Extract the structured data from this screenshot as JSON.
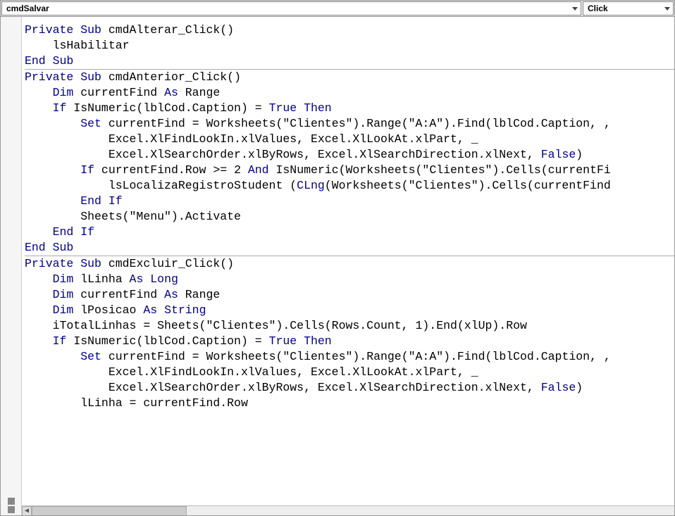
{
  "dropdowns": {
    "object": "cmdSalvar",
    "procedure": "Click"
  },
  "code": {
    "lines": [
      [
        [
          "kw",
          "Private"
        ],
        [
          "txt",
          " "
        ],
        [
          "kw",
          "Sub"
        ],
        [
          "txt",
          " cmdAlterar_Click()"
        ]
      ],
      [
        [
          "txt",
          "    lsHabilitar"
        ]
      ],
      [
        [
          "kw",
          "End"
        ],
        [
          "txt",
          " "
        ],
        [
          "kw",
          "Sub"
        ]
      ],
      "sep",
      [
        [
          "txt",
          ""
        ]
      ],
      [
        [
          "kw",
          "Private"
        ],
        [
          "txt",
          " "
        ],
        [
          "kw",
          "Sub"
        ],
        [
          "txt",
          " cmdAnterior_Click()"
        ]
      ],
      [
        [
          "txt",
          "    "
        ],
        [
          "kw",
          "Dim"
        ],
        [
          "txt",
          " currentFind "
        ],
        [
          "kw",
          "As"
        ],
        [
          "txt",
          " Range"
        ]
      ],
      [
        [
          "txt",
          ""
        ]
      ],
      [
        [
          "txt",
          "    "
        ],
        [
          "kw",
          "If"
        ],
        [
          "txt",
          " IsNumeric(lblCod.Caption) = "
        ],
        [
          "kw",
          "True"
        ],
        [
          "txt",
          " "
        ],
        [
          "kw",
          "Then"
        ]
      ],
      [
        [
          "txt",
          "        "
        ],
        [
          "kw",
          "Set"
        ],
        [
          "txt",
          " currentFind = Worksheets(\"Clientes\").Range(\"A:A\").Find(lblCod.Caption, ,"
        ]
      ],
      [
        [
          "txt",
          "            Excel.XlFindLookIn.xlValues, Excel.XlLookAt.xlPart, _"
        ]
      ],
      [
        [
          "txt",
          "            Excel.XlSearchOrder.xlByRows, Excel.XlSearchDirection.xlNext, "
        ],
        [
          "kw",
          "False"
        ],
        [
          "txt",
          ")"
        ]
      ],
      [
        [
          "txt",
          ""
        ]
      ],
      [
        [
          "txt",
          "        "
        ],
        [
          "kw",
          "If"
        ],
        [
          "txt",
          " currentFind.Row >= 2 "
        ],
        [
          "kw",
          "And"
        ],
        [
          "txt",
          " IsNumeric(Worksheets(\"Clientes\").Cells(currentFi"
        ]
      ],
      [
        [
          "txt",
          "            lsLocalizaRegistroStudent ("
        ],
        [
          "kw",
          "CLng"
        ],
        [
          "txt",
          "(Worksheets(\"Clientes\").Cells(currentFind"
        ]
      ],
      [
        [
          "txt",
          "        "
        ],
        [
          "kw",
          "End"
        ],
        [
          "txt",
          " "
        ],
        [
          "kw",
          "If"
        ]
      ],
      [
        [
          "txt",
          "        Sheets(\"Menu\").Activate"
        ]
      ],
      [
        [
          "txt",
          "    "
        ],
        [
          "kw",
          "End"
        ],
        [
          "txt",
          " "
        ],
        [
          "kw",
          "If"
        ]
      ],
      [
        [
          "kw",
          "End"
        ],
        [
          "txt",
          " "
        ],
        [
          "kw",
          "Sub"
        ]
      ],
      "sep",
      [
        [
          "txt",
          ""
        ]
      ],
      [
        [
          "kw",
          "Private"
        ],
        [
          "txt",
          " "
        ],
        [
          "kw",
          "Sub"
        ],
        [
          "txt",
          " cmdExcluir_Click()"
        ]
      ],
      [
        [
          "txt",
          "    "
        ],
        [
          "kw",
          "Dim"
        ],
        [
          "txt",
          " lLinha "
        ],
        [
          "kw",
          "As"
        ],
        [
          "txt",
          " "
        ],
        [
          "kw",
          "Long"
        ]
      ],
      [
        [
          "txt",
          "    "
        ],
        [
          "kw",
          "Dim"
        ],
        [
          "txt",
          " currentFind "
        ],
        [
          "kw",
          "As"
        ],
        [
          "txt",
          " Range"
        ]
      ],
      [
        [
          "txt",
          "    "
        ],
        [
          "kw",
          "Dim"
        ],
        [
          "txt",
          " lPosicao "
        ],
        [
          "kw",
          "As"
        ],
        [
          "txt",
          " "
        ],
        [
          "kw",
          "String"
        ]
      ],
      [
        [
          "txt",
          ""
        ]
      ],
      [
        [
          "txt",
          "    iTotalLinhas = Sheets(\"Clientes\").Cells(Rows.Count, 1).End(xlUp).Row"
        ]
      ],
      [
        [
          "txt",
          ""
        ]
      ],
      [
        [
          "txt",
          "    "
        ],
        [
          "kw",
          "If"
        ],
        [
          "txt",
          " IsNumeric(lblCod.Caption) = "
        ],
        [
          "kw",
          "True"
        ],
        [
          "txt",
          " "
        ],
        [
          "kw",
          "Then"
        ]
      ],
      [
        [
          "txt",
          "        "
        ],
        [
          "kw",
          "Set"
        ],
        [
          "txt",
          " currentFind = Worksheets(\"Clientes\").Range(\"A:A\").Find(lblCod.Caption, ,"
        ]
      ],
      [
        [
          "txt",
          "            Excel.XlFindLookIn.xlValues, Excel.XlLookAt.xlPart, _"
        ]
      ],
      [
        [
          "txt",
          "            Excel.XlSearchOrder.xlByRows, Excel.XlSearchDirection.xlNext, "
        ],
        [
          "kw",
          "False"
        ],
        [
          "txt",
          ")"
        ]
      ],
      [
        [
          "txt",
          ""
        ]
      ],
      [
        [
          "txt",
          "        lLinha = currentFind.Row"
        ]
      ]
    ]
  }
}
